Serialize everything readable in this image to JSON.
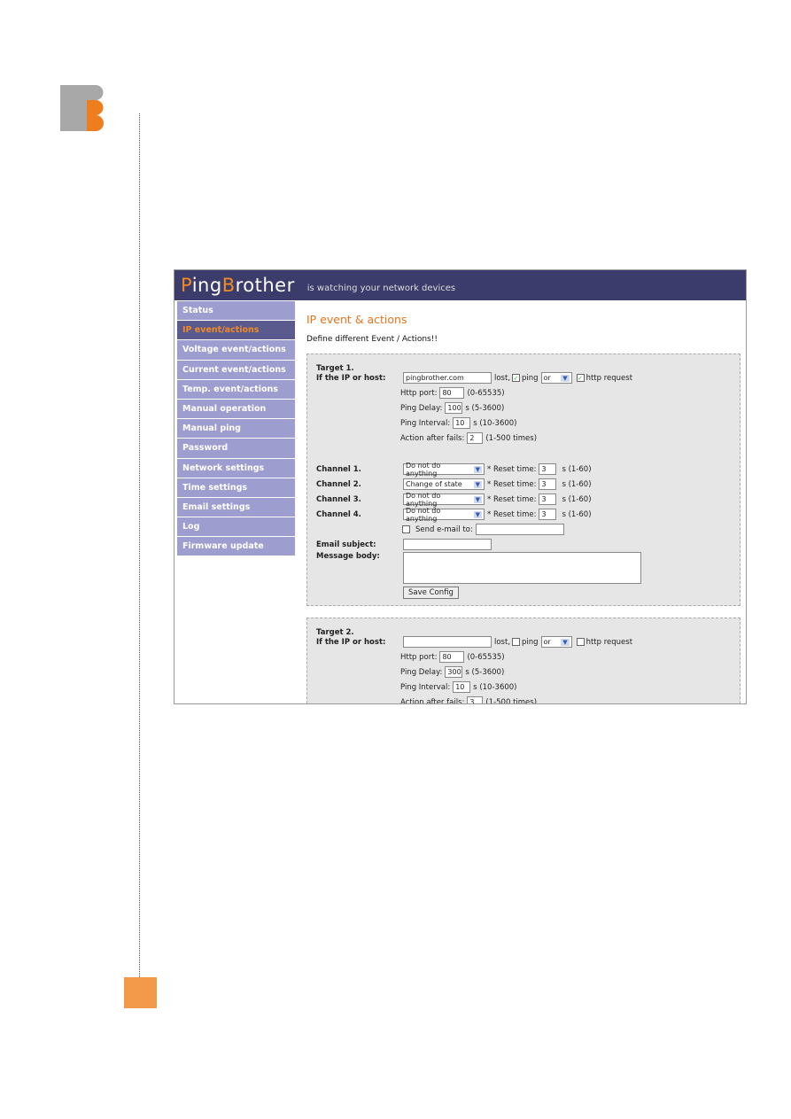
{
  "app": {
    "brand_p": "P",
    "brand_ing": "ing",
    "brand_b": "B",
    "brand_rother": "rother",
    "tagline": "is watching your network devices"
  },
  "sidebar": {
    "items": [
      {
        "label": "Status"
      },
      {
        "label": "IP event/actions",
        "active": true
      },
      {
        "label": "Voltage event/actions"
      },
      {
        "label": "Current event/actions"
      },
      {
        "label": "Temp. event/actions"
      },
      {
        "label": "Manual operation"
      },
      {
        "label": "Manual ping"
      },
      {
        "label": "Password"
      },
      {
        "label": "Network settings"
      },
      {
        "label": "Time settings"
      },
      {
        "label": "Email settings"
      },
      {
        "label": "Log"
      },
      {
        "label": "Firmware update"
      }
    ]
  },
  "main": {
    "title": "IP event & actions",
    "description": "Define different Event / Actions!!",
    "target1": {
      "title": "Target 1.",
      "host_label": "If the IP or host:",
      "host": "pingbrother.com",
      "lost": "lost,",
      "ping_label": "ping",
      "ping_checked": true,
      "or_value": "or",
      "http_label": "http request",
      "http_checked": true,
      "http_port_label": "Http port:",
      "http_port": "80",
      "http_port_range": "(0-65535)",
      "ping_delay_label": "Ping Delay:",
      "ping_delay": "100",
      "ping_delay_range": "s (5-3600)",
      "ping_interval_label": "Ping Interval:",
      "ping_interval": "10",
      "ping_interval_range": "s (10-3600)",
      "fails_label": "Action after fails:",
      "fails": "2",
      "fails_range": "(1-500 times)",
      "channels": [
        {
          "label": "Channel 1.",
          "action": "Do not do anything",
          "reset_label": "* Reset time:",
          "reset": "3",
          "range": "s (1-60)"
        },
        {
          "label": "Channel 2.",
          "action": "Change of state",
          "reset_label": "* Reset time:",
          "reset": "3",
          "range": "s (1-60)"
        },
        {
          "label": "Channel 3.",
          "action": "Do not do anything",
          "reset_label": "* Reset time:",
          "reset": "3",
          "range": "s (1-60)"
        },
        {
          "label": "Channel 4.",
          "action": "Do not do anything",
          "reset_label": "* Reset time:",
          "reset": "3",
          "range": "s (1-60)"
        }
      ],
      "send_email_label": "Send e-mail to:",
      "send_email_checked": false,
      "email_to": "",
      "subject_label": "Email subject:",
      "subject": "",
      "body_label": "Message body:",
      "body": "",
      "save_label": "Save Config"
    },
    "target2": {
      "title": "Target 2.",
      "host_label": "If the IP or host:",
      "host": "",
      "lost": "lost,",
      "ping_label": "ping",
      "ping_checked": false,
      "or_value": "or",
      "http_label": "http request",
      "http_checked": false,
      "http_port_label": "Http port:",
      "http_port": "80",
      "http_port_range": "(0-65535)",
      "ping_delay_label": "Ping Delay:",
      "ping_delay": "300",
      "ping_delay_range": "s (5-3600)",
      "ping_interval_label": "Ping Interval:",
      "ping_interval": "10",
      "ping_interval_range": "s (10-3600)",
      "fails_label": "Action after fails:",
      "fails": "3",
      "fails_range": "(1-500 times)"
    }
  },
  "colors": {
    "header": "#3b3b6c",
    "sidebar": "#9d9dcf",
    "accent": "#f08a24",
    "page_orange": "#f29a4a"
  }
}
